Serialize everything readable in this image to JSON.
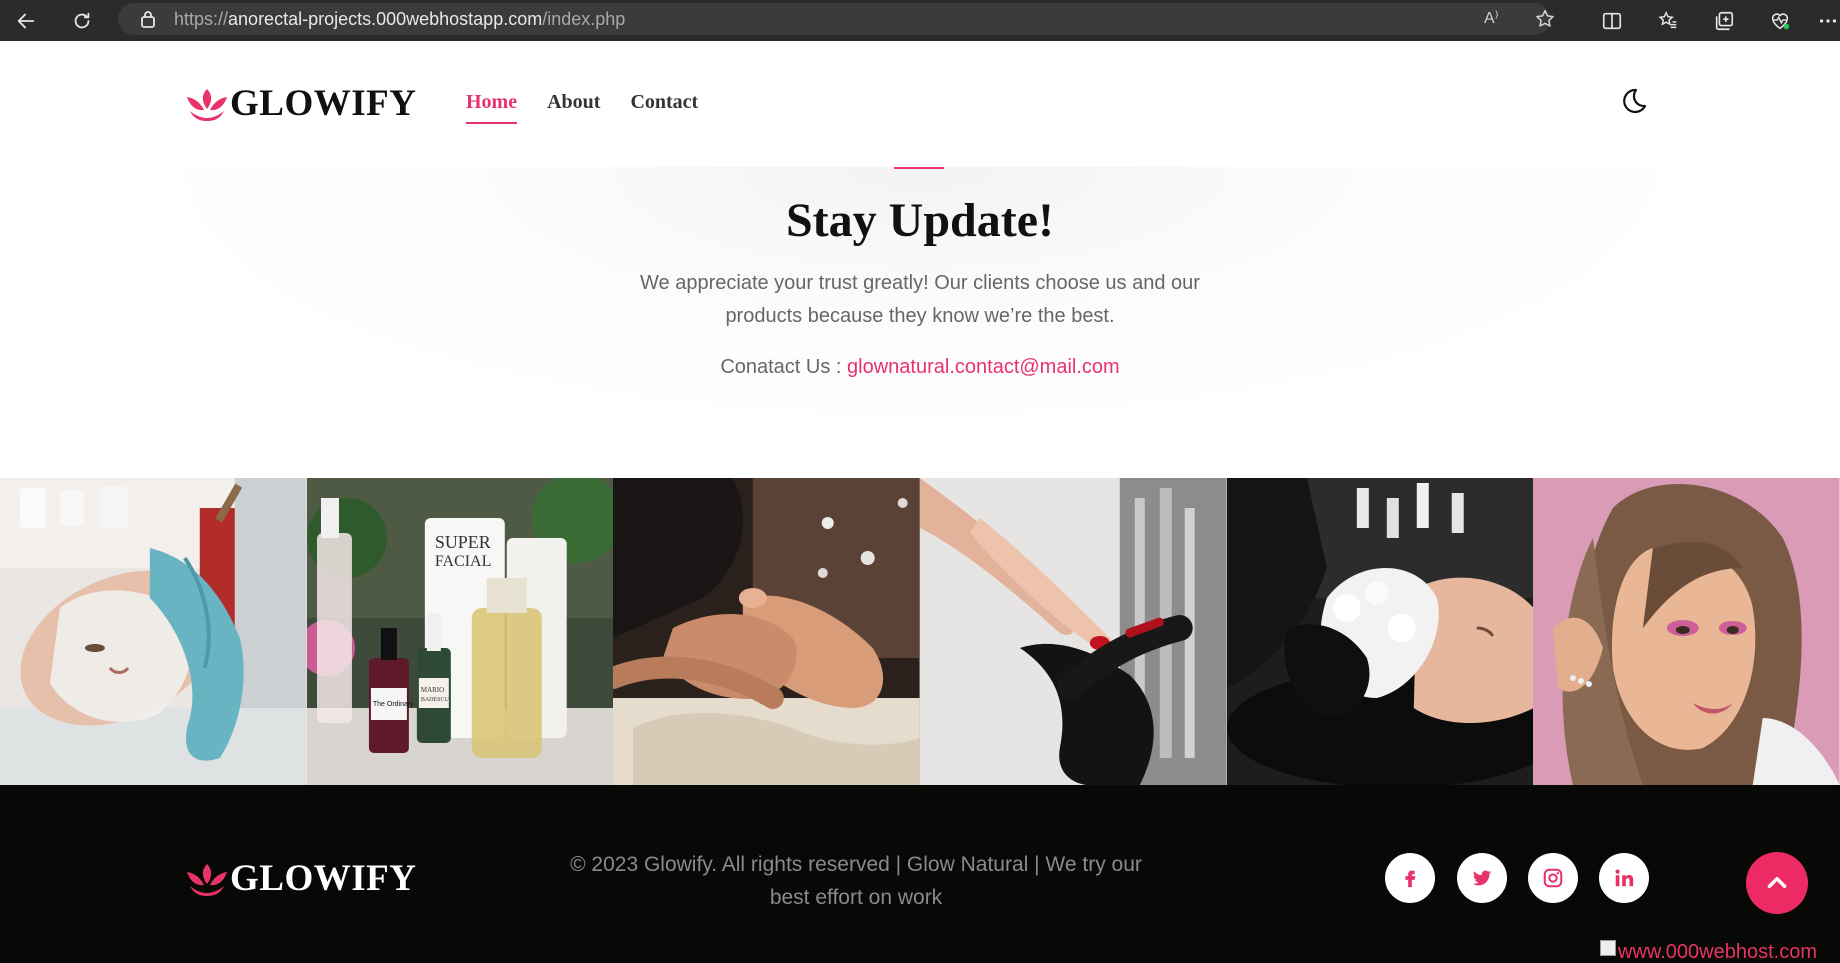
{
  "browser": {
    "url_scheme": "https://",
    "url_host": "anorectal-projects.000webhostapp.com",
    "url_path": "/index.php",
    "read_aloud_label": "A⁾"
  },
  "header": {
    "logo_text": "GLOWIFY",
    "nav": [
      {
        "label": "Home",
        "active": true
      },
      {
        "label": "About",
        "active": false
      },
      {
        "label": "Contact",
        "active": false
      }
    ]
  },
  "hero": {
    "title": "Stay Update!",
    "description": "We appreciate your trust greatly! Our clients choose us and our products because they know we’re the best.",
    "contact_label": "Conatact Us :",
    "contact_email": "glownatural.contact@mail.com"
  },
  "gallery": [
    {
      "subject": "facial-mask"
    },
    {
      "subject": "skincare-products",
      "labels": [
        "SUPER",
        "FACIAL",
        "MARIO",
        "BADESCU",
        "The Ordinary"
      ]
    },
    {
      "subject": "foot-massage"
    },
    {
      "subject": "nail-polish"
    },
    {
      "subject": "hair-wash"
    },
    {
      "subject": "makeup-portrait"
    }
  ],
  "footer": {
    "logo_text": "GLOWIFY",
    "copyright": "© 2023 Glowify. All rights reserved | Glow Natural | We try our best effort on work",
    "social": [
      "facebook",
      "twitter",
      "instagram",
      "linkedin"
    ],
    "host_badge": "www.000webhost.com"
  },
  "colors": {
    "accent": "#e8336a",
    "footer_bg": "#080806",
    "chrome_bg": "#2b2b2b"
  }
}
